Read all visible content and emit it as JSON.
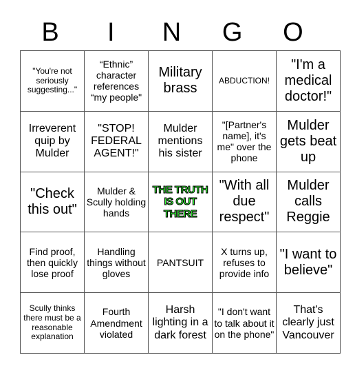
{
  "header": [
    "B",
    "I",
    "N",
    "G",
    "O"
  ],
  "free_color": "#33ff33",
  "rows": [
    [
      {
        "text": "\"You're not seriously suggesting...\"",
        "size": "xs"
      },
      {
        "text": "“Ethnic” character references “my people\"",
        "size": "sm"
      },
      {
        "text": "Military brass",
        "size": "lg"
      },
      {
        "text": "ABDUCTION!",
        "size": "xs"
      },
      {
        "text": "\"I'm a medical doctor!\"",
        "size": "lg"
      }
    ],
    [
      {
        "text": "Irreverent quip by Mulder",
        "size": "md"
      },
      {
        "text": "\"STOP! FEDERAL AGENT!\"",
        "size": "md"
      },
      {
        "text": "Mulder mentions his sister",
        "size": "md"
      },
      {
        "text": "\"[Partner's name], it's me\" over the phone",
        "size": "sm"
      },
      {
        "text": "Mulder gets beat up",
        "size": "lg"
      }
    ],
    [
      {
        "text": "\"Check this out\"",
        "size": "lg"
      },
      {
        "text": "Mulder & Scully holding hands",
        "size": "sm"
      },
      {
        "text": "THE TRUTH IS OUT THERE",
        "size": "free"
      },
      {
        "text": "\"With all due respect\"",
        "size": "lg"
      },
      {
        "text": "Mulder calls Reggie",
        "size": "lg"
      }
    ],
    [
      {
        "text": "Find proof, then quickly lose proof",
        "size": "sm"
      },
      {
        "text": "Handling things without gloves",
        "size": "sm"
      },
      {
        "text": "PANTSUIT",
        "size": "sm"
      },
      {
        "text": "X turns up, refuses to provide info",
        "size": "sm"
      },
      {
        "text": "\"I want to believe\"",
        "size": "lg"
      }
    ],
    [
      {
        "text": "Scully thinks there must be a reasonable explanation",
        "size": "xs"
      },
      {
        "text": "Fourth Amendment violated",
        "size": "sm"
      },
      {
        "text": "Harsh lighting in a dark forest",
        "size": "md"
      },
      {
        "text": "\"I don't want to talk about it on the phone\"",
        "size": "sm"
      },
      {
        "text": "That's clearly just Vancouver",
        "size": "md"
      }
    ]
  ]
}
